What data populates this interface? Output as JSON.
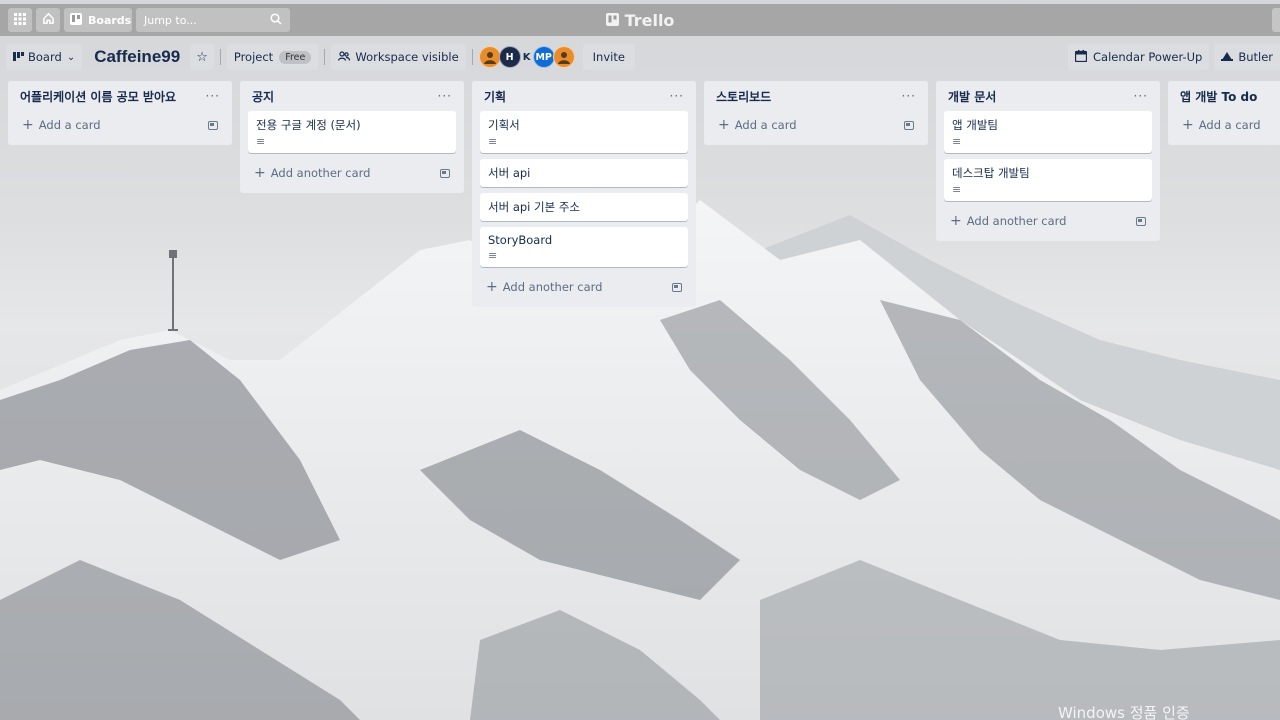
{
  "topbar": {
    "boards_label": "Boards",
    "search_placeholder": "Jump to...",
    "logo_text": "Trello"
  },
  "board": {
    "view_label": "Board",
    "title": "Caffeine99",
    "workspace_label": "Project",
    "plan_badge": "Free",
    "visibility_label": "Workspace visible",
    "members": [
      "H",
      "K",
      "MP"
    ],
    "invite_label": "Invite",
    "calendar_label": "Calendar Power-Up",
    "butler_label": "Butler"
  },
  "lists": [
    {
      "title": "어플리케이션 이름 공모 받아요",
      "cards": [],
      "add_label": "Add a card"
    },
    {
      "title": "공지",
      "cards": [
        {
          "text": "전용 구글 계정 (문서)",
          "has_desc": true
        }
      ],
      "add_label": "Add another card"
    },
    {
      "title": "기획",
      "cards": [
        {
          "text": "기획서",
          "has_desc": true
        },
        {
          "text": "서버 api",
          "has_desc": false
        },
        {
          "text": "서버 api 기본 주소",
          "has_desc": false
        },
        {
          "text": "StoryBoard",
          "has_desc": true
        }
      ],
      "add_label": "Add another card"
    },
    {
      "title": "스토리보드",
      "cards": [],
      "add_label": "Add a card"
    },
    {
      "title": "개발 문서",
      "cards": [
        {
          "text": "앱 개발팀",
          "has_desc": true
        },
        {
          "text": "데스크탑 개발팀",
          "has_desc": true
        }
      ],
      "add_label": "Add another card"
    },
    {
      "title": "앱 개발 To do",
      "cards": [],
      "add_label": "Add a card"
    }
  ],
  "watermark": "Windows 정품 인증"
}
